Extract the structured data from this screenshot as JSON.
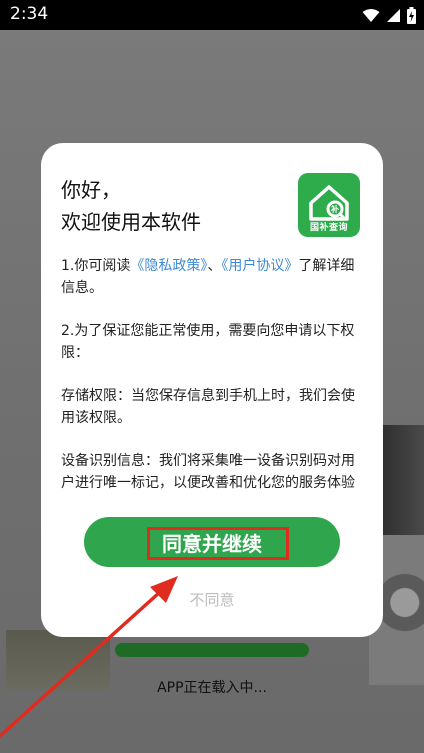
{
  "status_bar": {
    "time": "2:34",
    "icons": [
      "wifi-icon",
      "signal-icon",
      "battery-charging-icon"
    ]
  },
  "splash": {
    "loading_text": "APP正在载入中...",
    "loading_progress": 0.0
  },
  "dialog": {
    "greeting": "你好，",
    "welcome": "欢迎使用本软件",
    "logo_text": "国补查询",
    "p1_prefix": "1.你可阅读",
    "privacy_link": "《隐私政策》",
    "p1_sep": "、",
    "agreement_link": "《用户协议》",
    "p1_suffix": "了解详细信息。",
    "p2": "2.为了保证您能正常使用，需要向您申请以下权限：",
    "p3": "存储权限：当您保存信息到手机上时，我们会使用该权限。",
    "p4": "设备识别信息：我们将采集唯一设备识别码对用户进行唯一标记，以便改善和优化您的服务体验并保障您的账号安全。",
    "agree_label": "同意并继续",
    "disagree_label": "不同意"
  },
  "colors": {
    "accent_green": "#2fa64d",
    "link_blue": "#3f8ad6",
    "highlight_red": "#e02b1f"
  }
}
